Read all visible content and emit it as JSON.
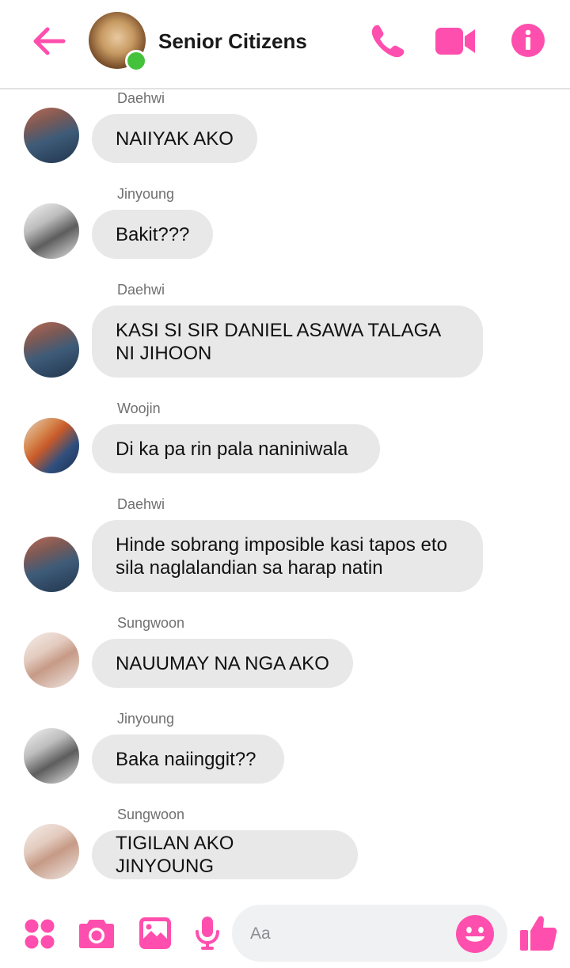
{
  "header": {
    "title": "Senior Citizens",
    "icons": [
      "back-arrow-icon",
      "group-photo",
      "phone-icon",
      "video-camera-icon",
      "info-icon"
    ],
    "accent_color": "#ff4fae",
    "online_color": "#44c23c"
  },
  "messages": [
    {
      "sender": "Daehwi",
      "text": "NAIIYAK AKO"
    },
    {
      "sender": "Jinyoung",
      "text": "Bakit???"
    },
    {
      "sender": "Daehwi",
      "text": "KASI SI SIR DANIEL ASAWA TALAGA NI JIHOON"
    },
    {
      "sender": "Woojin",
      "text": "Di ka pa rin pala naniniwala"
    },
    {
      "sender": "Daehwi",
      "text": "Hinde sobrang imposible kasi tapos eto sila naglalandian sa harap natin"
    },
    {
      "sender": "Sungwoon",
      "text": "NAUUMAY NA NGA AKO"
    },
    {
      "sender": "Jinyoung",
      "text": "Baka naiinggit??"
    },
    {
      "sender": "Sungwoon",
      "text": "TIGILAN AKO JINYOUNG"
    }
  ],
  "composer": {
    "placeholder": "Aa",
    "icons": [
      "apps-grid-icon",
      "camera-icon",
      "gallery-icon",
      "microphone-icon",
      "emoji-icon",
      "thumbs-up-icon"
    ]
  }
}
